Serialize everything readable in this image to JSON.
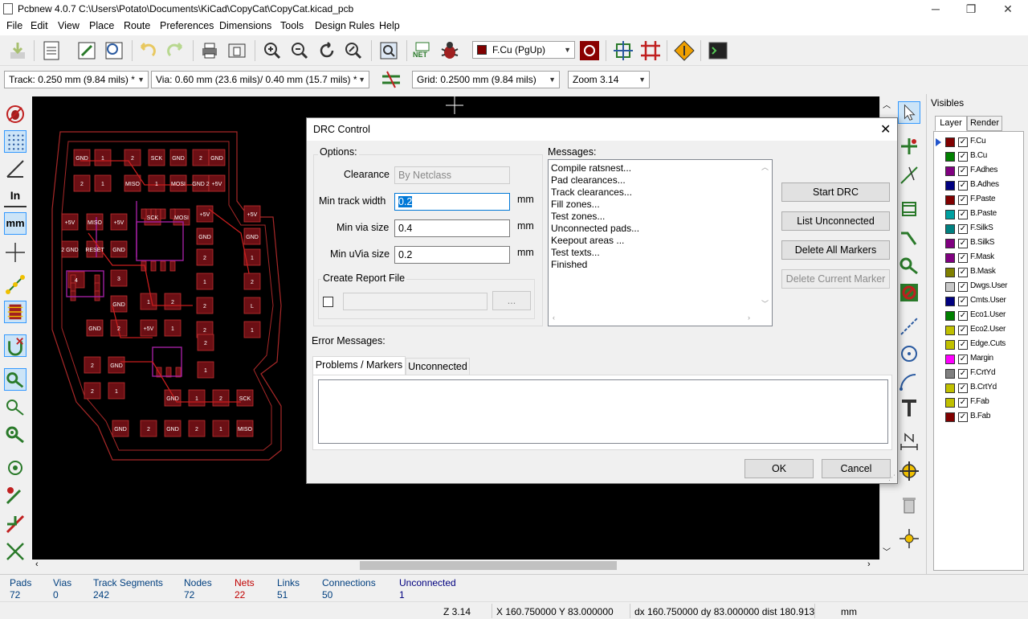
{
  "window": {
    "title": "Pcbnew 4.0.7 C:\\Users\\Potato\\Documents\\KiCad\\CopyCat\\CopyCat.kicad_pcb",
    "minimize": "─",
    "restore": "❐",
    "close": "✕"
  },
  "menu": [
    "File",
    "Edit",
    "View",
    "Place",
    "Route",
    "Preferences",
    "Dimensions",
    "Tools",
    "Design Rules",
    "Help"
  ],
  "toolbar": {
    "layer_select": "F.Cu (PgUp)",
    "layer_color": "#800000",
    "net_label": "NET"
  },
  "toolbar2": {
    "track": "Track: 0.250 mm (9.84 mils) *",
    "via": "Via: 0.60 mm (23.6 mils)/ 0.40 mm (15.7 mils) *",
    "grid": "Grid: 0.2500 mm (9.84 mils)",
    "zoom": "Zoom 3.14"
  },
  "left_toolbar": {
    "units_in": "In",
    "units_mm": "mm"
  },
  "dialog": {
    "title": "DRC Control",
    "close": "✕",
    "options_label": "Options:",
    "clearance_label": "Clearance",
    "clearance_value": "By Netclass",
    "min_track_label": "Min track width",
    "min_track_value": "0.2",
    "min_via_label": "Min via size",
    "min_via_value": "0.4",
    "min_uvia_label": "Min uVia size",
    "min_uvia_value": "0.2",
    "unit": "mm",
    "report_label": "Create Report File",
    "browse": "...",
    "messages_label": "Messages:",
    "messages": [
      "Compile ratsnest...",
      "Pad clearances...",
      "Track clearances...",
      "Fill zones...",
      "Test zones...",
      "Unconnected pads...",
      "Keepout areas ...",
      "Test texts...",
      "Finished"
    ],
    "buttons": {
      "start": "Start DRC",
      "list": "List Unconnected",
      "delete_all": "Delete All Markers",
      "delete_current": "Delete Current Marker"
    },
    "error_label": "Error Messages:",
    "tabs": [
      "Problems / Markers",
      "Unconnected"
    ],
    "ok": "OK",
    "cancel": "Cancel"
  },
  "visibles": {
    "title": "Visibles",
    "tabs": [
      "Layer",
      "Render"
    ],
    "layers": [
      {
        "name": "F.Cu",
        "color": "#800000",
        "selected": true
      },
      {
        "name": "B.Cu",
        "color": "#008000"
      },
      {
        "name": "F.Adhes",
        "color": "#800080"
      },
      {
        "name": "B.Adhes",
        "color": "#000080"
      },
      {
        "name": "F.Paste",
        "color": "#800000"
      },
      {
        "name": "B.Paste",
        "color": "#00a0a0"
      },
      {
        "name": "F.SilkS",
        "color": "#008080"
      },
      {
        "name": "B.SilkS",
        "color": "#800080"
      },
      {
        "name": "F.Mask",
        "color": "#800080"
      },
      {
        "name": "B.Mask",
        "color": "#808000"
      },
      {
        "name": "Dwgs.User",
        "color": "#c8c8c8"
      },
      {
        "name": "Cmts.User",
        "color": "#000080"
      },
      {
        "name": "Eco1.User",
        "color": "#008000"
      },
      {
        "name": "Eco2.User",
        "color": "#c0c000"
      },
      {
        "name": "Edge.Cuts",
        "color": "#c0c000"
      },
      {
        "name": "Margin",
        "color": "#ff00ff"
      },
      {
        "name": "F.CrtYd",
        "color": "#808080"
      },
      {
        "name": "B.CrtYd",
        "color": "#c0c000"
      },
      {
        "name": "F.Fab",
        "color": "#c0c000"
      },
      {
        "name": "B.Fab",
        "color": "#800000"
      }
    ]
  },
  "status": {
    "pads_label": "Pads",
    "pads": "72",
    "vias_label": "Vias",
    "vias": "0",
    "tracks_label": "Track Segments",
    "tracks": "242",
    "nodes_label": "Nodes",
    "nodes": "72",
    "nets_label": "Nets",
    "nets": "22",
    "links_label": "Links",
    "links": "51",
    "connections_label": "Connections",
    "connections": "50",
    "unconnected_label": "Unconnected",
    "unconnected": "1",
    "zoom": "Z 3.14",
    "xy": "X 160.750000  Y 83.000000",
    "delta": "dx 160.750000  dy 83.000000  dist 180.913",
    "units": "mm"
  },
  "pcb_labels": [
    "GND",
    "1",
    "2",
    "SCK",
    "GND",
    "2",
    "GND",
    "2",
    "1",
    "MISO",
    "1",
    "MOSI",
    "GND 2",
    "+5V",
    "+5V",
    "MISO",
    "+5V",
    "SCK",
    "MOSI",
    "+5V",
    "+5V",
    "2 GND",
    "RESET",
    "GND",
    "GND",
    "GND",
    "2",
    "1",
    "2",
    "1",
    "4",
    "3",
    "GND",
    "1",
    "2",
    "2",
    "L",
    "GND",
    "2",
    "+5V",
    "1",
    "2",
    "1",
    "2",
    "1",
    "2",
    "GND",
    "2",
    "1"
  ]
}
